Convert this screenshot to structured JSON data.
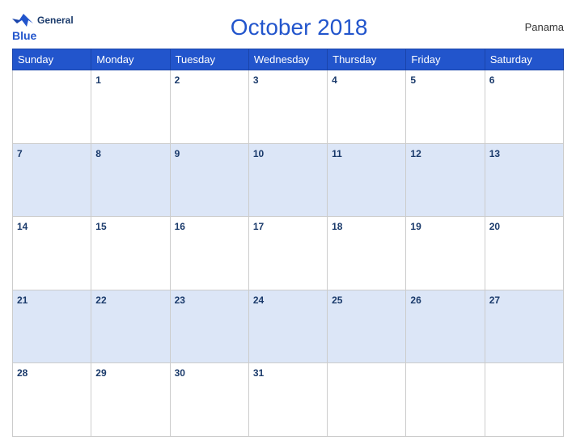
{
  "header": {
    "title": "October 2018",
    "country": "Panama",
    "logo_general": "General",
    "logo_blue": "Blue"
  },
  "days": [
    "Sunday",
    "Monday",
    "Tuesday",
    "Wednesday",
    "Thursday",
    "Friday",
    "Saturday"
  ],
  "weeks": [
    [
      "",
      "1",
      "2",
      "3",
      "4",
      "5",
      "6"
    ],
    [
      "7",
      "8",
      "9",
      "10",
      "11",
      "12",
      "13"
    ],
    [
      "14",
      "15",
      "16",
      "17",
      "18",
      "19",
      "20"
    ],
    [
      "21",
      "22",
      "23",
      "24",
      "25",
      "26",
      "27"
    ],
    [
      "28",
      "29",
      "30",
      "31",
      "",
      "",
      ""
    ]
  ],
  "row_styles": [
    "row-white",
    "row-blue",
    "row-white",
    "row-blue",
    "row-white"
  ]
}
